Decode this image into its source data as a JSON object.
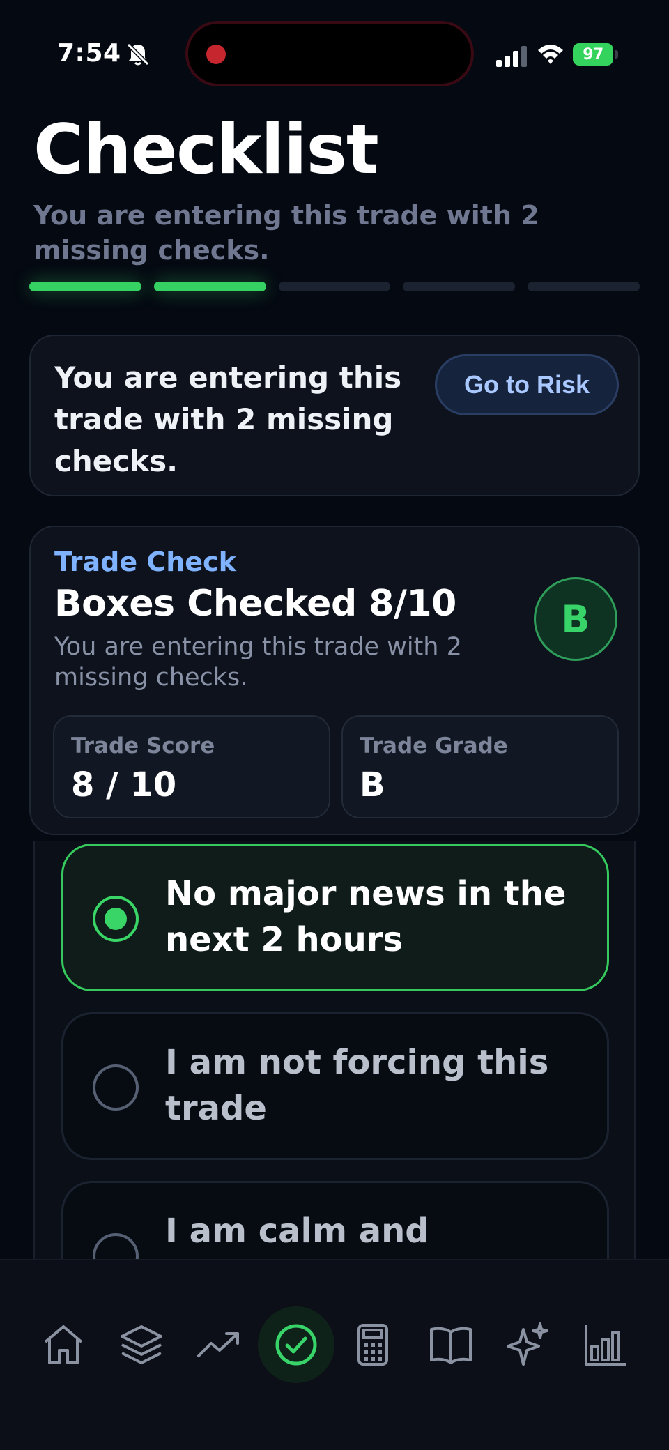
{
  "status_bar": {
    "time": "7:54",
    "battery": "97"
  },
  "header": {
    "title": "Checklist",
    "subtitle": "You are entering this trade with 2 missing checks."
  },
  "progress": {
    "total_segments": 5,
    "filled_segments": 2,
    "accent_color": "#35d162"
  },
  "warning_card": {
    "message": "You are entering this trade with 2 missing checks.",
    "button_label": "Go to Risk"
  },
  "trade_check": {
    "label": "Trade Check",
    "title": "Boxes Checked 8/10",
    "description": "You are entering this trade with 2 missing checks.",
    "grade_badge": "B",
    "score_label": "Trade Score",
    "score_value": "8 / 10",
    "grade_label": "Trade Grade",
    "grade_value": "B"
  },
  "checklist": {
    "items": [
      {
        "text": "No major news in the next 2 hours",
        "checked": true
      },
      {
        "text": "I am not forcing this trade",
        "checked": false
      },
      {
        "text": "I am calm and thinking",
        "checked": false
      }
    ]
  },
  "tab_bar": {
    "tabs": [
      {
        "icon": "home-icon"
      },
      {
        "icon": "layers-icon"
      },
      {
        "icon": "trend-up-icon"
      },
      {
        "icon": "check-circle-icon",
        "active": true
      },
      {
        "icon": "calculator-icon"
      },
      {
        "icon": "book-icon"
      },
      {
        "icon": "sparkles-icon"
      },
      {
        "icon": "bar-chart-icon"
      }
    ]
  }
}
